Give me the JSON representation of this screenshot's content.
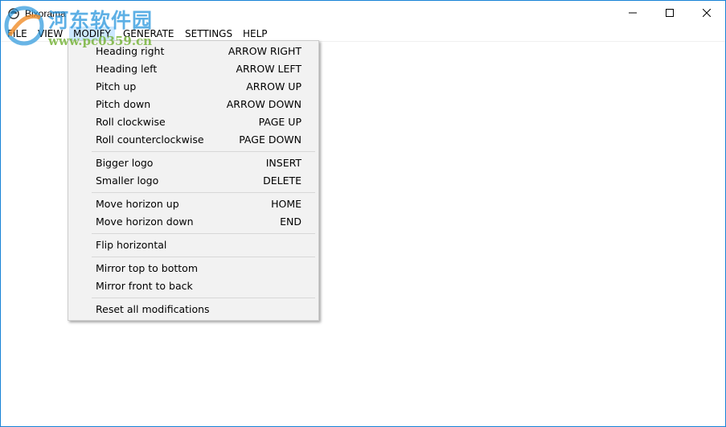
{
  "window": {
    "title": "Bixorama"
  },
  "menubar": {
    "items": [
      "FILE",
      "VIEW",
      "MODIFY",
      "GENERATE",
      "SETTINGS",
      "HELP"
    ]
  },
  "modify_menu": {
    "groups": [
      [
        {
          "label": "Heading right",
          "shortcut": "ARROW RIGHT"
        },
        {
          "label": "Heading left",
          "shortcut": "ARROW LEFT"
        },
        {
          "label": "Pitch up",
          "shortcut": "ARROW UP"
        },
        {
          "label": "Pitch down",
          "shortcut": "ARROW DOWN"
        },
        {
          "label": "Roll clockwise",
          "shortcut": "PAGE UP"
        },
        {
          "label": "Roll counterclockwise",
          "shortcut": "PAGE DOWN"
        }
      ],
      [
        {
          "label": "Bigger logo",
          "shortcut": "INSERT"
        },
        {
          "label": "Smaller logo",
          "shortcut": "DELETE"
        }
      ],
      [
        {
          "label": "Move horizon up",
          "shortcut": "HOME"
        },
        {
          "label": "Move horizon down",
          "shortcut": "END"
        }
      ],
      [
        {
          "label": "Flip horizontal",
          "shortcut": ""
        }
      ],
      [
        {
          "label": "Mirror top to bottom",
          "shortcut": ""
        },
        {
          "label": "Mirror front to back",
          "shortcut": ""
        }
      ],
      [
        {
          "label": "Reset all modifications",
          "shortcut": ""
        }
      ]
    ]
  },
  "watermark": {
    "site_name": "河东软件园",
    "url": "www.pc0359.cn"
  },
  "colors": {
    "window_border": "#1883d7",
    "menu_background": "#f2f2f2",
    "active_menu_highlight": "#cce8ff"
  }
}
